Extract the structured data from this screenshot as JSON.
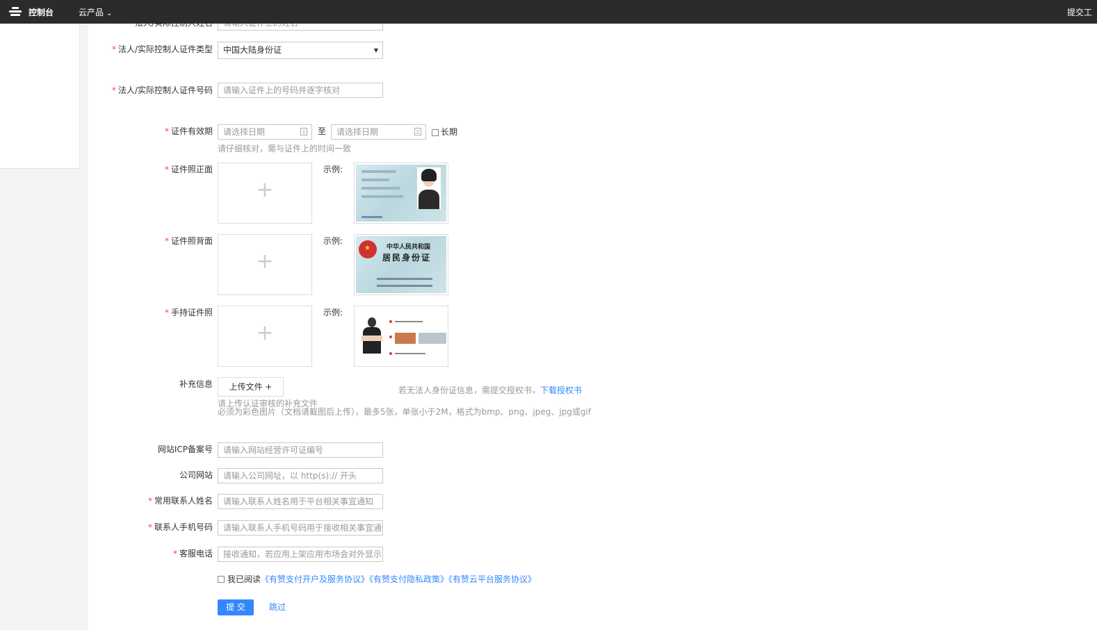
{
  "topbar": {
    "console": "控制台",
    "products": "云产品",
    "submit": "提交工"
  },
  "form": {
    "legal_name": {
      "label": "法人/实际控制人姓名",
      "placeholder": "请输入证件上的姓名"
    },
    "id_type": {
      "label": "法人/实际控制人证件类型",
      "value": "中国大陆身份证"
    },
    "id_number": {
      "label": "法人/实际控制人证件号码",
      "placeholder": "请输入证件上的号码并逐字核对"
    },
    "validity": {
      "label": "证件有效期",
      "start_placeholder": "请选择日期",
      "separator": "至",
      "end_placeholder": "请选择日期",
      "long_term": "长期",
      "hint": "请仔细核对，需与证件上的时间一致"
    },
    "id_front": {
      "label": "证件照正面",
      "sample": "示例:"
    },
    "id_back": {
      "label": "证件照背面",
      "sample": "示例:",
      "card_title1": "中华人民共和国",
      "card_title2": "居民身份证"
    },
    "hand_held": {
      "label": "手持证件照",
      "sample": "示例:"
    },
    "supplement": {
      "label": "补充信息",
      "button": "上传文件 +",
      "hint1": "请上传认证审核的补充文件",
      "hint2": "必须为彩色图片（文档请截图后上传），最多5张，单张小于2M，格式为bmp、png、jpeg、jpg或gif",
      "auth_note": "若无法人身份证信息，需提交授权书，",
      "auth_link": "下载授权书"
    },
    "icp": {
      "label": "网站ICP备案号",
      "placeholder": "请输入网站经营许可证编号"
    },
    "website": {
      "label": "公司网站",
      "placeholder": "请输入公司网址，以 http(s):// 开头"
    },
    "contact_name": {
      "label": "常用联系人姓名",
      "placeholder": "请输入联系人姓名用于平台相关事宜通知"
    },
    "contact_phone": {
      "label": "联系人手机号码",
      "placeholder": "请输入联系人手机号码用于接收相关事宜通知"
    },
    "service_phone": {
      "label": "客服电话",
      "placeholder": "接收通知，若应用上架应用市场会对外显示"
    },
    "agreement": {
      "prefix": "我已阅读",
      "link1": "《有赞支付开户及服务协议》",
      "link2": "《有赞支付隐私政策》",
      "link3": "《有赞云平台服务协议》"
    },
    "submit": "提 交",
    "skip": "跳过"
  }
}
